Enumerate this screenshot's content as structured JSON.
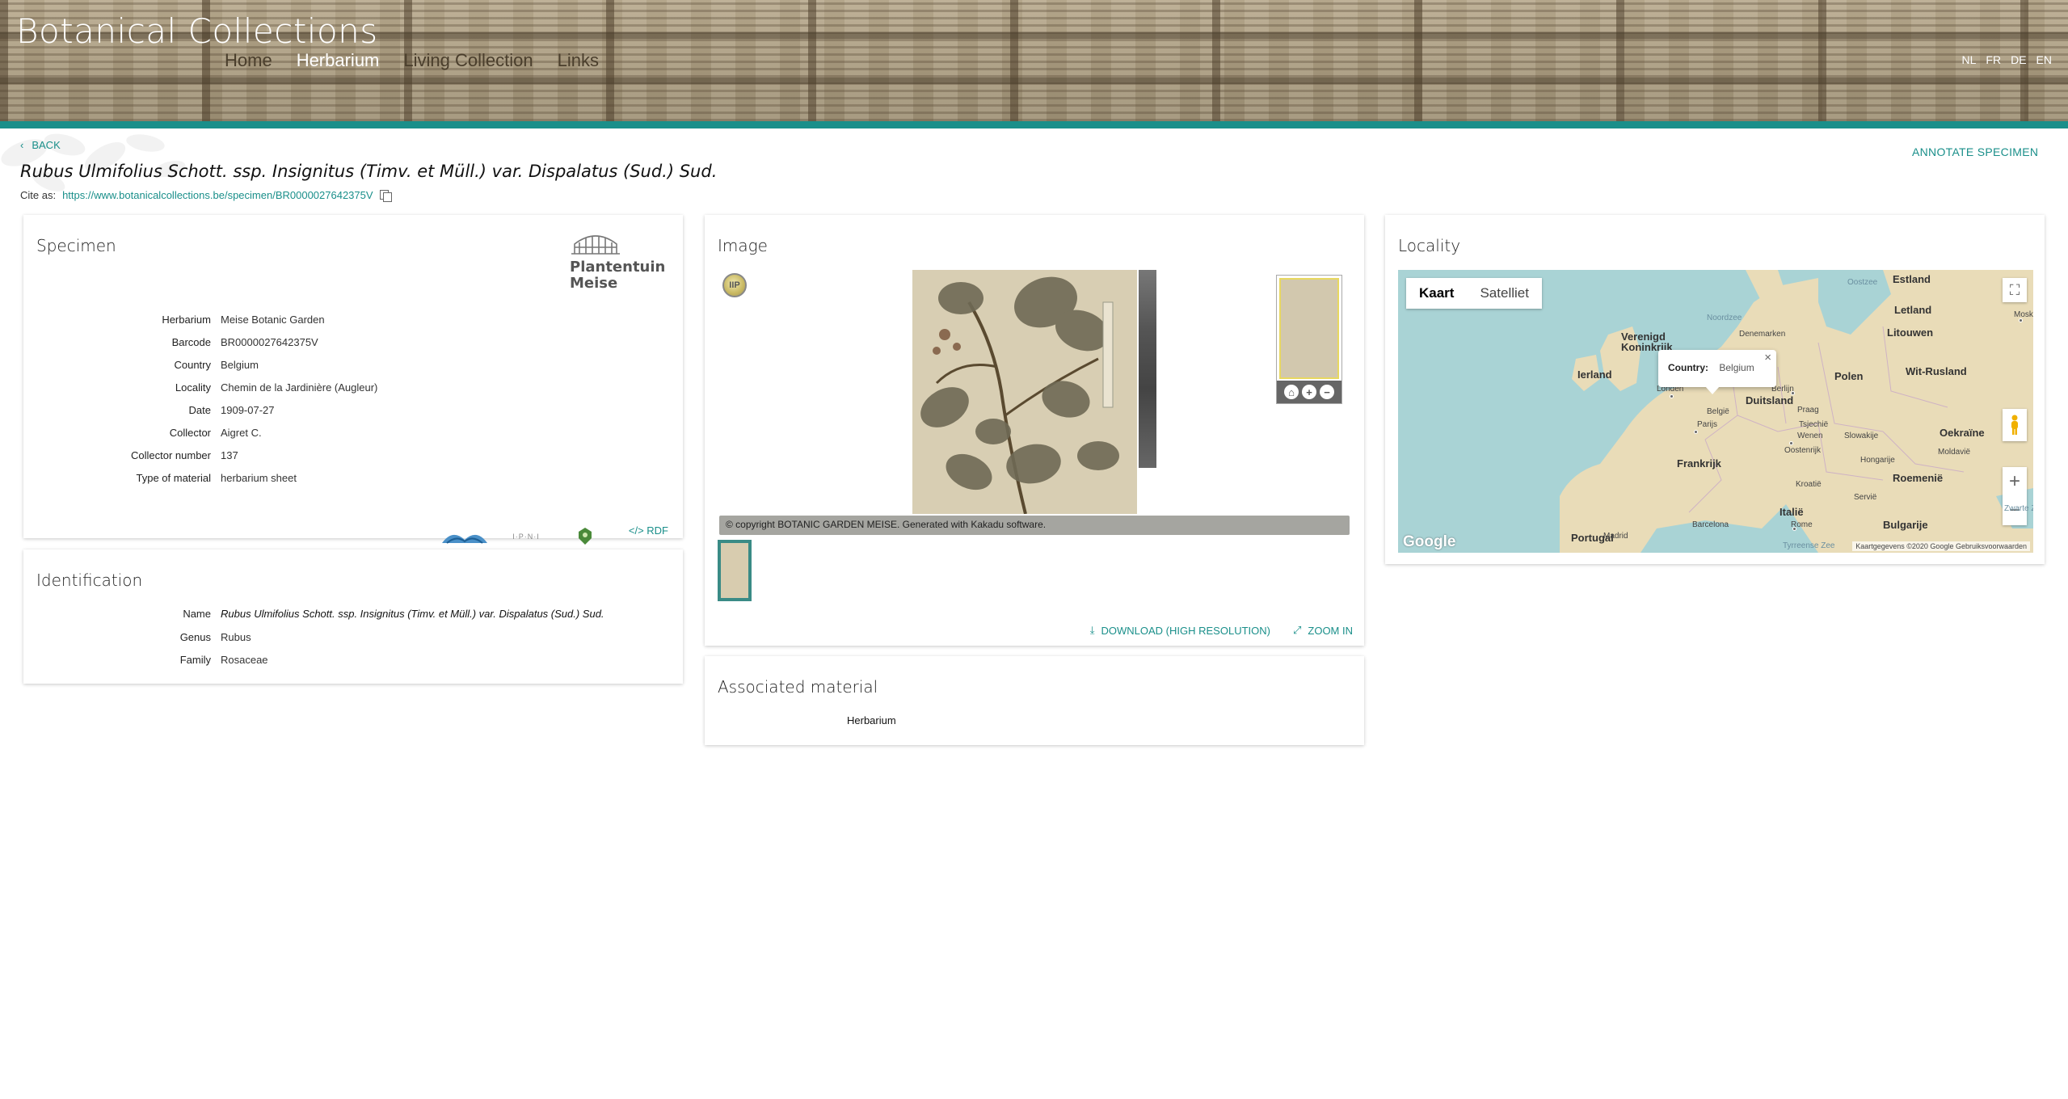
{
  "header": {
    "site_title": "Botanical Collections",
    "nav": [
      "Home",
      "Herbarium",
      "Living Collection",
      "Links"
    ],
    "languages": [
      "NL",
      "FR",
      "DE",
      "EN"
    ]
  },
  "back_label": "BACK",
  "annotate_label": "ANNOTATE SPECIMEN",
  "page_title": "Rubus Ulmifolius Schott. ssp. Insignitus (Timv. et Müll.) var. Dispalatus (Sud.) Sud.",
  "cite": {
    "label": "Cite as:",
    "url": "https://www.botanicalcollections.be/specimen/BR0000027642375V"
  },
  "specimen": {
    "title": "Specimen",
    "logo_text": [
      "Plantentuin",
      "Meise"
    ],
    "fields": [
      {
        "key": "Herbarium",
        "value": "Meise Botanic Garden"
      },
      {
        "key": "Barcode",
        "value": "BR0000027642375V"
      },
      {
        "key": "Country",
        "value": "Belgium"
      },
      {
        "key": "Locality",
        "value": "Chemin de la Jardinière (Augleur)"
      },
      {
        "key": "Date",
        "value": "1909-07-27"
      },
      {
        "key": "Collector",
        "value": "Aigret C."
      },
      {
        "key": "Collector number",
        "value": "137"
      },
      {
        "key": "Type of material",
        "value": "herbarium sheet"
      }
    ],
    "rdf_label": "RDF",
    "partner_logos": [
      "gbif-logo",
      "ipni-logo",
      "botanic-garden-emblem"
    ],
    "ipni_text": "I·P·N·I"
  },
  "identification": {
    "title": "Identification",
    "fields": [
      {
        "key": "Name",
        "value": "Rubus Ulmifolius Schott. ssp. Insignitus (Timv. et Müll.) var. Dispalatus (Sud.) Sud."
      },
      {
        "key": "Genus",
        "value": "Rubus"
      },
      {
        "key": "Family",
        "value": "Rosaceae"
      }
    ]
  },
  "image": {
    "title": "Image",
    "iip_label": "IIP",
    "copyright": "© copyright BOTANIC GARDEN MEISE. Generated with Kakadu software.",
    "download_label": "DOWNLOAD (HIGH RESOLUTION)",
    "zoom_label": "ZOOM IN"
  },
  "associated": {
    "title": "Associated material",
    "items": [
      "Herbarium"
    ]
  },
  "locality": {
    "title": "Locality",
    "map_types": [
      "Kaart",
      "Satelliet"
    ],
    "active_map_type": "Kaart",
    "info_label": "Country:",
    "info_value": "Belgium",
    "countries": [
      "Estland",
      "Letland",
      "Litouwen",
      "Verenigd Koninkrijk",
      "Denemarken",
      "Ierland",
      "Polen",
      "Wit-Rusland",
      "Duitsland",
      "België",
      "Tsjechië",
      "Oekraïne",
      "Frankrijk",
      "Oostenrijk",
      "Hongarije",
      "Moldavië",
      "Roemenië",
      "Kroatië",
      "Servië",
      "Italië",
      "Bulgarije",
      "Portugal",
      "Slowakije"
    ],
    "cities": [
      "Moskou",
      "Berlijn",
      "Londen",
      "Parijs",
      "Praag",
      "Wenen",
      "Rome",
      "Barcelona",
      "Madrid"
    ],
    "seas": [
      "Noordzee",
      "Oostzee",
      "Tyrreense Zee",
      "Zwarte Zee"
    ],
    "google": "Google",
    "attribution": "Kaartgegevens ©2020 Google  Gebruiksvoorwaarden"
  },
  "colors": {
    "accent": "#1a8f8a",
    "water": "#a9d3d5",
    "land": "#e9dcb8"
  }
}
